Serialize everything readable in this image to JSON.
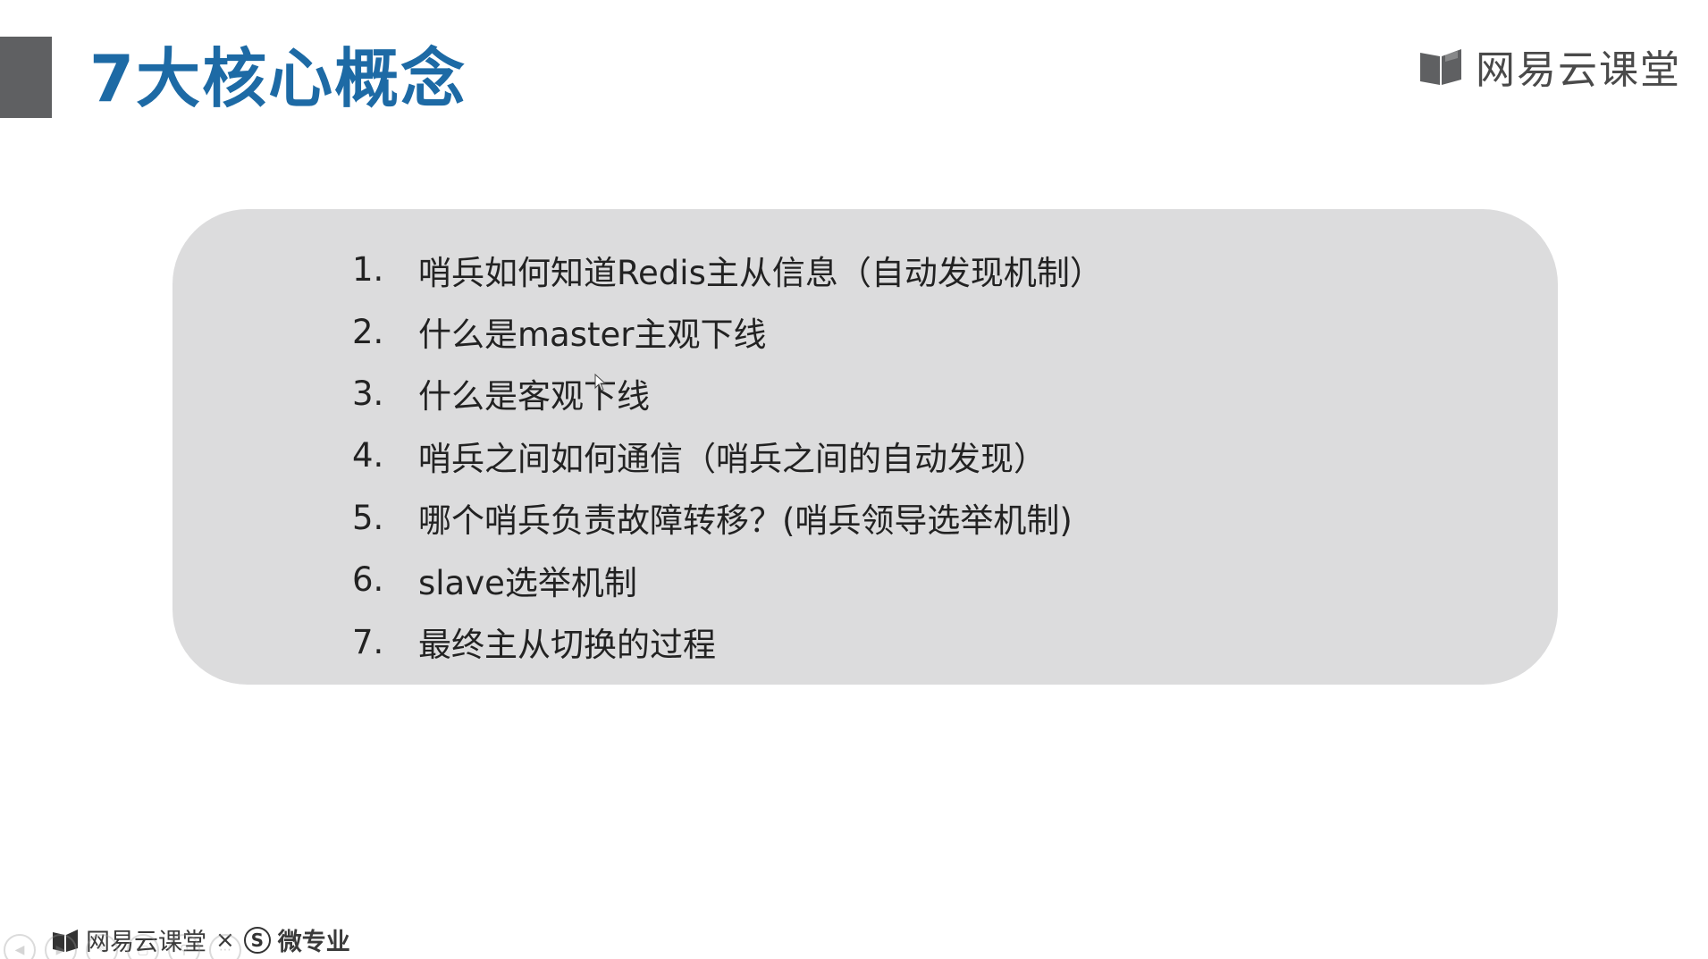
{
  "slide": {
    "title": "7大核心概念",
    "brand": "网易云课堂",
    "accent_color": "#1d6aa5",
    "bar_color": "#5f6062",
    "panel_color": "#dcdcdd"
  },
  "concepts": [
    {
      "num": "1.",
      "text": "哨兵如何知道Redis主从信息（自动发现机制）"
    },
    {
      "num": "2.",
      "text": "什么是master主观下线"
    },
    {
      "num": "3.",
      "text": "什么是客观下线"
    },
    {
      "num": "4.",
      "text": "哨兵之间如何通信（哨兵之间的自动发现）"
    },
    {
      "num": "5.",
      "text": "哪个哨兵负责故障转移？(哨兵领导选举机制)"
    },
    {
      "num": "6.",
      "text": "slave选举机制"
    },
    {
      "num": "7.",
      "text": "最终主从切换的过程"
    }
  ],
  "footer": {
    "brand": "网易云课堂",
    "separator": "×",
    "partner_mark": "S",
    "partner": "微专业"
  },
  "nav_controls": [
    {
      "icon": "arrow-left-icon",
      "glyph": "◀"
    },
    {
      "icon": "arrow-right-icon",
      "glyph": "▶"
    },
    {
      "icon": "pen-icon",
      "glyph": "✎"
    },
    {
      "icon": "slides-icon",
      "glyph": "▢"
    },
    {
      "icon": "zoom-icon",
      "glyph": "⚲"
    },
    {
      "icon": "more-icon",
      "glyph": "⋯"
    }
  ]
}
